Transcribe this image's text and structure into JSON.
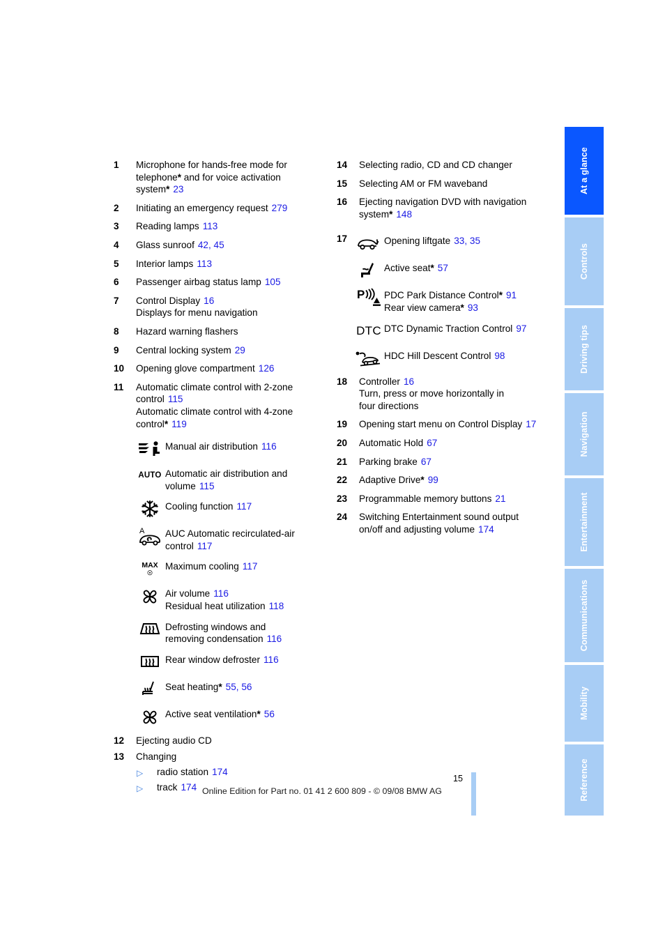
{
  "document": {
    "page_number": "15",
    "footer_note": "Online Edition for Part no. 01 41 2 600 809 - © 09/08 BMW AG"
  },
  "colors": {
    "page_link": "#1b1be4",
    "tab_active": "#0a57ff",
    "tab_inactive": "#a8cdf5",
    "bullet": "#3b7ddd"
  },
  "side_tabs": [
    {
      "label": "At a glance",
      "active": true
    },
    {
      "label": "Controls",
      "active": false
    },
    {
      "label": "Driving tips",
      "active": false
    },
    {
      "label": "Navigation",
      "active": false
    },
    {
      "label": "Entertainment",
      "active": false
    },
    {
      "label": "Communications",
      "active": false
    },
    {
      "label": "Mobility",
      "active": false
    },
    {
      "label": "Reference",
      "active": false
    }
  ],
  "left_column": {
    "entries": [
      {
        "num": "1",
        "line1": "Microphone for hands-free mode for",
        "line2": "telephone",
        "star2": "*",
        "line2b": " and for voice activation",
        "line3": "system",
        "star3": "*",
        "page3": "23"
      },
      {
        "num": "2",
        "line1": "Initiating an emergency request",
        "page1": "279"
      },
      {
        "num": "3",
        "line1": "Reading lamps",
        "page1": "113"
      },
      {
        "num": "4",
        "line1": "Glass sunroof",
        "page1": "42, 45"
      },
      {
        "num": "5",
        "line1": "Interior lamps",
        "page1": "113"
      },
      {
        "num": "6",
        "line1": "Passenger airbag status lamp",
        "page1": "105"
      },
      {
        "num": "7",
        "line1": "Control Display",
        "page1": "16",
        "line2": "Displays for menu navigation"
      },
      {
        "num": "8",
        "line1": "Hazard warning flashers"
      },
      {
        "num": "9",
        "line1": "Central locking system",
        "page1": "29"
      },
      {
        "num": "10",
        "line1": "Opening glove compartment",
        "page1": "126"
      },
      {
        "num": "11",
        "line1": "Automatic climate control with 2-zone",
        "line2": "control",
        "page2": "115",
        "line3": "Automatic climate control with 4-zone",
        "line4": "control",
        "star4": "*",
        "page4": "119"
      }
    ],
    "climate_icons": [
      {
        "icon": "manual-air-distribution-icon",
        "line1": "Manual air distribution",
        "page1": "116"
      },
      {
        "icon": "auto-text-icon",
        "glyph": "AUTO",
        "line1": "Automatic air distribution and",
        "line2": "volume",
        "page2": "115"
      },
      {
        "icon": "snowflake-cooling-icon",
        "line1": "Cooling function",
        "page1": "117"
      },
      {
        "icon": "auc-recirculated-air-icon",
        "line1": "AUC Automatic recirculated-air",
        "line2": "control",
        "page2": "117"
      },
      {
        "icon": "max-cooling-icon",
        "glyph": "MAX",
        "line1": "Maximum cooling",
        "page1": "117"
      },
      {
        "icon": "fan-air-volume-icon",
        "line1": "Air volume",
        "page1": "116",
        "line2": "Residual heat utilization",
        "page2": "118"
      },
      {
        "icon": "windshield-defroster-icon",
        "line1": "Defrosting windows and",
        "line2": "removing condensation",
        "page2": "116"
      },
      {
        "icon": "rear-window-defroster-icon",
        "line1": "Rear window defroster",
        "page1": "116"
      },
      {
        "icon": "seat-heating-icon",
        "line1": "Seat heating",
        "star1": "*",
        "page1": "55, 56"
      },
      {
        "icon": "active-seat-ventilation-icon",
        "line1": "Active seat ventilation",
        "star1": "*",
        "page1": "56"
      }
    ],
    "entries_tail": [
      {
        "num": "12",
        "line1": "Ejecting audio CD"
      },
      {
        "num": "13",
        "line1": "Changing"
      }
    ],
    "bullets": [
      {
        "label": "radio station",
        "page": "174"
      },
      {
        "label": "track",
        "page": "174"
      }
    ]
  },
  "right_column": {
    "entries_head": [
      {
        "num": "14",
        "line1": "Selecting radio, CD and CD changer"
      },
      {
        "num": "15",
        "line1": "Selecting AM or FM waveband"
      },
      {
        "num": "16",
        "line1": "Ejecting navigation DVD with navigation",
        "line2": "system",
        "star2": "*",
        "page2": "148"
      }
    ],
    "group17": {
      "num": "17",
      "icons": [
        {
          "icon": "liftgate-icon",
          "line1": "Opening liftgate",
          "page1": "33, 35"
        },
        {
          "icon": "active-seat-icon",
          "line1": "Active seat",
          "star1": "*",
          "page1": "57"
        },
        {
          "icon": "pdc-park-distance-icon",
          "line1": "PDC Park Distance Control",
          "star1": "*",
          "page1": "91",
          "line2": "Rear view camera",
          "star2": "*",
          "page2": "93"
        },
        {
          "icon": "dtc-text-icon",
          "glyph": "DTC",
          "line1": "DTC Dynamic Traction Control",
          "page1": "97"
        },
        {
          "icon": "hdc-hill-descent-icon",
          "line1": "HDC Hill Descent Control",
          "page1": "98"
        }
      ]
    },
    "entries_tail": [
      {
        "num": "18",
        "line1": "Controller",
        "page1": "16",
        "line2": "Turn, press or move horizontally in",
        "line3": "four directions"
      },
      {
        "num": "19",
        "line1": "Opening start menu on Control Display",
        "page1": "17"
      },
      {
        "num": "20",
        "line1": "Automatic Hold",
        "page1": "67"
      },
      {
        "num": "21",
        "line1": "Parking brake",
        "page1": "67"
      },
      {
        "num": "22",
        "line1": "Adaptive Drive",
        "star1": "*",
        "page1": "99"
      },
      {
        "num": "23",
        "line1": "Programmable memory buttons",
        "page1": "21"
      },
      {
        "num": "24",
        "line1": "Switching Entertainment sound output",
        "line2": "on/off and adjusting volume",
        "page2": "174"
      }
    ]
  }
}
